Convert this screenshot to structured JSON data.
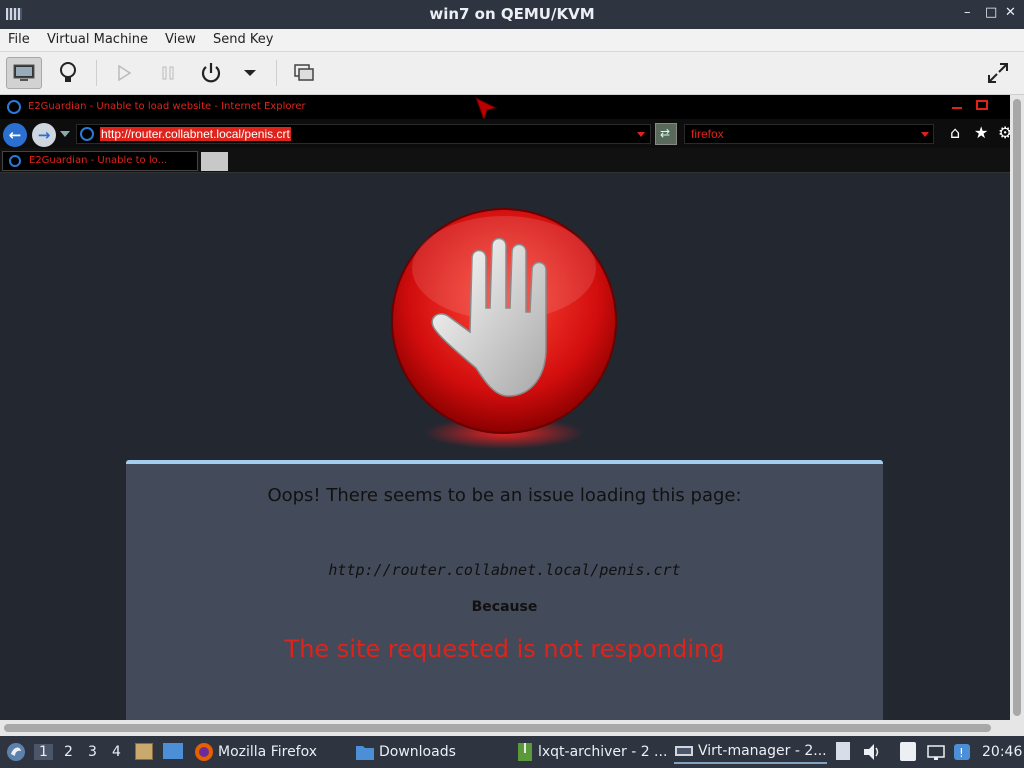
{
  "window": {
    "title": "win7 on QEMU/KVM",
    "minimize": "–",
    "maximize": "□",
    "close": "✕"
  },
  "menu": [
    "File",
    "Virtual Machine",
    "View",
    "Send Key"
  ],
  "guest": {
    "ie_title": "E2Guardian - Unable to load website - Internet Explorer",
    "url": "http://router.collabnet.local/penis.crt",
    "search_text": "firefox",
    "tab_label": "E2Guardian - Unable to lo...",
    "error": {
      "heading": "Oops! There seems to be an issue loading this page:",
      "url": "http://router.collabnet.local/penis.crt",
      "because": "Because",
      "reason": "The site requested is not responding"
    }
  },
  "taskbar": {
    "workspaces": [
      "1",
      "2",
      "3",
      "4"
    ],
    "tasks": [
      "Mozilla Firefox",
      "Downloads",
      "lxqt-archiver - 2 ...",
      "Virt-manager - 2..."
    ],
    "clock": "20:46"
  },
  "colors": {
    "accent_red": "#e0231a",
    "panel": "#434a59",
    "panel_border": "#a4cdee"
  }
}
